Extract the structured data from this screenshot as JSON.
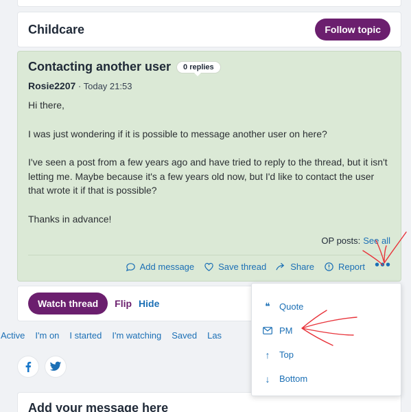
{
  "topic": {
    "title": "Childcare",
    "follow_label": "Follow topic"
  },
  "post": {
    "title": "Contacting another user",
    "replies_badge": "0 replies",
    "author": "Rosie2207",
    "separator": " · ",
    "timestamp": "Today 21:53",
    "paragraphs": [
      "Hi there,",
      "I was just wondering if it is possible to message another user on here?",
      "I've seen a post from a few years ago and have tried to reply to the thread, but it isn't letting me. Maybe because it's a few years old now, but I'd like to contact the user that wrote it if that is possible?",
      "Thanks in advance!"
    ],
    "op_posts_label": "OP posts:",
    "see_all_label": "See all",
    "actions": {
      "add_message": "Add message",
      "save_thread": "Save thread",
      "share": "Share",
      "report": "Report",
      "more": "•••"
    }
  },
  "watch_bar": {
    "watch_label": "Watch thread",
    "flip_label": "Flip",
    "hide_label": "Hide"
  },
  "tabs": [
    "Active",
    "I'm on",
    "I started",
    "I'm watching",
    "Saved",
    "Las"
  ],
  "add_message_section": {
    "title": "Add your message here"
  },
  "more_menu": {
    "items": [
      {
        "label": "Quote",
        "icon": "quote-icon"
      },
      {
        "label": "PM",
        "icon": "mail-icon"
      },
      {
        "label": "Top",
        "icon": "arrow-up-icon"
      },
      {
        "label": "Bottom",
        "icon": "arrow-down-icon"
      }
    ]
  },
  "colors": {
    "brand_purple": "#6b1f6e",
    "link_blue": "#1b6fb5",
    "post_bg": "#dbe9d6",
    "annotation_red": "#e8333a"
  }
}
